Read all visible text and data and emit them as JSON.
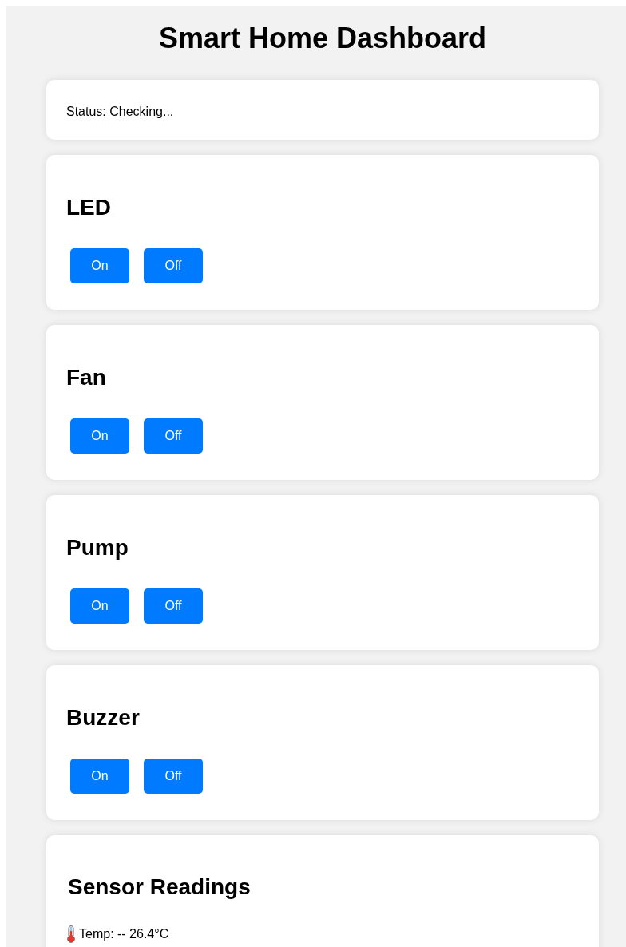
{
  "title": "Smart Home Dashboard",
  "status": "Status: Checking...",
  "devices": [
    {
      "name": "LED",
      "buttons": [
        "On",
        "Off"
      ]
    },
    {
      "name": "Fan",
      "buttons": [
        "On",
        "Off"
      ]
    },
    {
      "name": "Pump",
      "buttons": [
        "On",
        "Off"
      ]
    },
    {
      "name": "Buzzer",
      "buttons": [
        "On",
        "Off"
      ]
    }
  ],
  "sensors": {
    "title": "Sensor Readings",
    "readings": [
      {
        "text": "Temp: -- 26.4°C"
      }
    ]
  }
}
